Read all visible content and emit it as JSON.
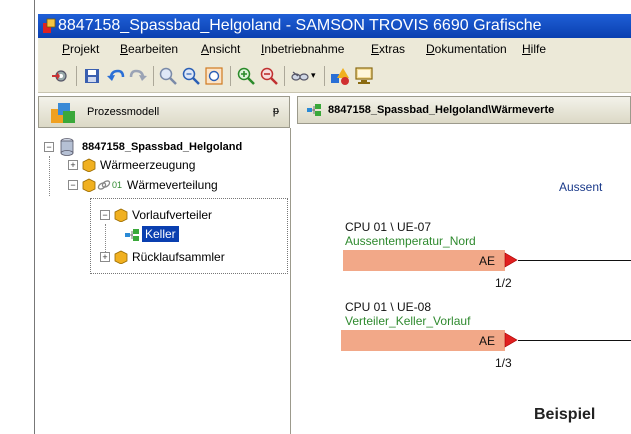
{
  "window": {
    "title": "8847158_Spassbad_Helgoland  -  SAMSON TROVIS 6690 Grafische"
  },
  "menu": [
    {
      "pre": "",
      "ul": "P",
      "post": "rojekt"
    },
    {
      "pre": "",
      "ul": "B",
      "post": "earbeiten"
    },
    {
      "pre": "",
      "ul": "A",
      "post": "nsicht"
    },
    {
      "pre": "",
      "ul": "I",
      "post": "nbetriebnahme"
    },
    {
      "pre": "",
      "ul": "E",
      "post": "xtras"
    },
    {
      "pre": "",
      "ul": "D",
      "post": "okumentation"
    },
    {
      "pre": "",
      "ul": "H",
      "post": "ilfe"
    }
  ],
  "sidebar": {
    "title": "Prozessmodell",
    "pin": "ᵽ"
  },
  "tree": {
    "root": "8847158_Spassbad_Helgoland",
    "items": [
      "Wärmeerzeugung",
      "Wärmeverteilung",
      "Vorlaufverteiler",
      "Keller",
      "Rücklaufsammler"
    ],
    "prefix_01": "01",
    "expanders": {
      "plus": "+",
      "minus": "−"
    }
  },
  "document": {
    "tab_title": "8847158_Spassbad_Helgoland\\Wärmeverte",
    "header_text": "Aussent",
    "blocks": [
      {
        "cpu": "CPU 01 \\ UE-07",
        "name": "Aussentemperatur_Nord",
        "port": "AE",
        "index": "1/2"
      },
      {
        "cpu": "CPU 01 \\ UE-08",
        "name": "Verteiler_Keller_Vorlauf",
        "port": "AE",
        "index": "1/3"
      }
    ]
  },
  "caption": "Beispiel",
  "colors": {
    "accent": "#0a3fb0",
    "block_fill": "#f2a888",
    "port_marker": "#e02020",
    "signal_name": "#2f8a2f"
  }
}
